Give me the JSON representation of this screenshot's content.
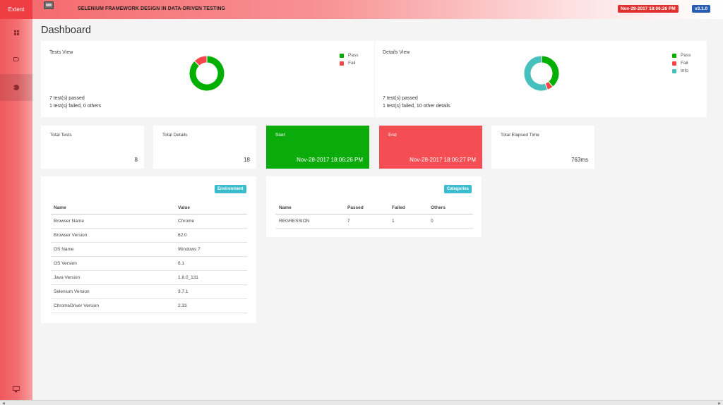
{
  "header": {
    "brand": "Extent",
    "logo_icon": "browser-window-icon",
    "title": "SELENIUM FRAMEWORK DESIGN IN DATA-DRIVEN TESTING",
    "timestamp": "Nov-28-2017 18:06:26 PM",
    "version": "v3.1.0"
  },
  "sidebar": {
    "items": [
      {
        "name": "dashboard",
        "icon": "grid-icon"
      },
      {
        "name": "tests",
        "icon": "tag-icon"
      },
      {
        "name": "analytics",
        "icon": "pie-chart-icon"
      }
    ],
    "bottom_icon": "monitor-icon"
  },
  "dashboard": {
    "title": "Dashboard",
    "tests_view": {
      "label": "Tests View",
      "legend": [
        {
          "label": "Pass",
          "color": "#00af00"
        },
        {
          "label": "Fail",
          "color": "#f7464a"
        }
      ],
      "line1": "7 test(s) passed",
      "line2": "1 test(s) failed, 0 others"
    },
    "details_view": {
      "label": "Details View",
      "legend": [
        {
          "label": "Pass",
          "color": "#00af00"
        },
        {
          "label": "Fail",
          "color": "#f7464a"
        },
        {
          "label": "Info",
          "color": "#46bfbd"
        }
      ],
      "line1": "7 test(s) passed",
      "line2": "1 test(s) failed, 10 other details"
    },
    "stats": [
      {
        "title": "Total Tests",
        "value": "8"
      },
      {
        "title": "Total Details",
        "value": "18"
      },
      {
        "title": "Start",
        "value": "Nov-28-2017 18:06:26 PM"
      },
      {
        "title": "End",
        "value": "Nov-28-2017 18:06:27 PM"
      },
      {
        "title": "Total Elapsed Time",
        "value": "763ms"
      }
    ],
    "environment": {
      "badge": "Environment",
      "headers": [
        "Name",
        "Value"
      ],
      "rows": [
        [
          "Browser Name",
          "Chrome"
        ],
        [
          "Browser Version",
          "62.0"
        ],
        [
          "OS Name",
          "Windows 7"
        ],
        [
          "OS Version",
          "6.1"
        ],
        [
          "Java Version",
          "1.8.0_131"
        ],
        [
          "Selenium Version",
          "3.7.1"
        ],
        [
          "ChromeDriver Version",
          "2.33"
        ]
      ]
    },
    "categories": {
      "badge": "Categories",
      "headers": [
        "Name",
        "Passed",
        "Failed",
        "Others"
      ],
      "rows": [
        [
          "REGRESSION",
          "7",
          "1",
          "0"
        ]
      ]
    }
  },
  "chart_data": [
    {
      "type": "pie",
      "variant": "doughnut",
      "labels": [
        "Pass",
        "Fail"
      ],
      "values": [
        7,
        1
      ],
      "colors": [
        "#00af00",
        "#f7464a"
      ]
    },
    {
      "type": "pie",
      "variant": "doughnut",
      "labels": [
        "Pass",
        "Fail",
        "Info"
      ],
      "values": [
        7,
        1,
        10
      ],
      "colors": [
        "#00af00",
        "#f7464a",
        "#46bfbd"
      ]
    }
  ]
}
